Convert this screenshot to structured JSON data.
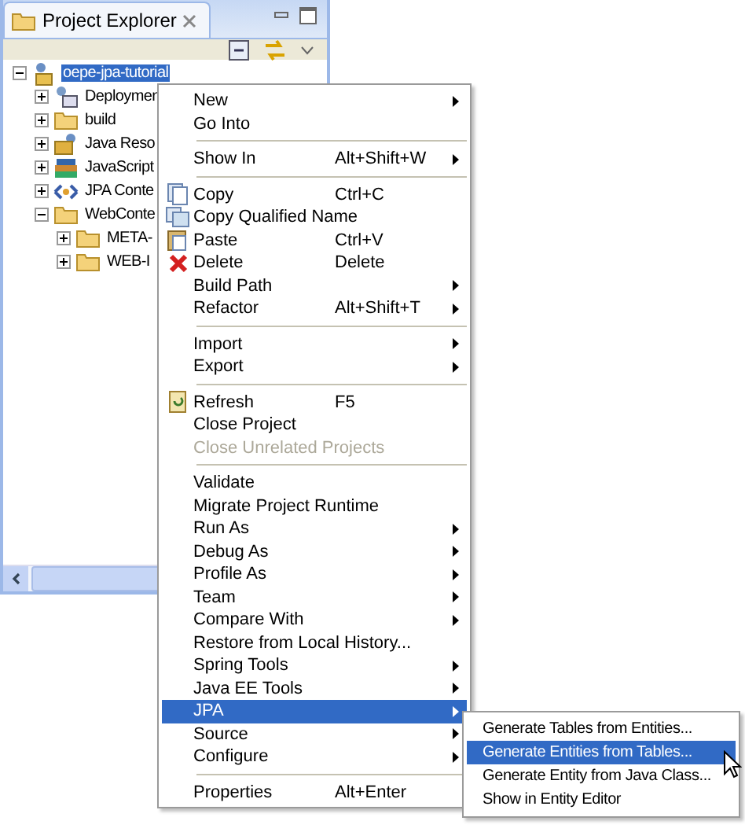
{
  "panel": {
    "title": "Project Explorer"
  },
  "tree": [
    {
      "label": "oepe-jpa-tutorial",
      "selected": true,
      "expanded": true,
      "children": [
        {
          "label": "Deploymen",
          "expanded": false
        },
        {
          "label": "build",
          "expanded": false
        },
        {
          "label": "Java Reso",
          "expanded": false
        },
        {
          "label": "JavaScript",
          "expanded": false
        },
        {
          "label": "JPA Conte",
          "expanded": false
        },
        {
          "label": "WebConte",
          "expanded": true,
          "children": [
            {
              "label": "META-",
              "expanded": false
            },
            {
              "label": "WEB-I",
              "expanded": false
            }
          ]
        }
      ]
    }
  ],
  "menu": [
    {
      "kind": "item",
      "label": "New",
      "submenu": true,
      "disabled": false,
      "selected": false
    },
    {
      "kind": "item",
      "label": "Go Into",
      "submenu": false,
      "disabled": false,
      "selected": false
    },
    {
      "kind": "separator"
    },
    {
      "kind": "item",
      "label": "Show In",
      "shortcut": "Alt+Shift+W",
      "submenu": true,
      "disabled": false,
      "selected": false
    },
    {
      "kind": "separator"
    },
    {
      "kind": "item",
      "label": "Copy",
      "shortcut": "Ctrl+C",
      "submenu": false,
      "disabled": false,
      "selected": false
    },
    {
      "kind": "item",
      "label": "Copy Qualified Name",
      "submenu": false,
      "disabled": false,
      "selected": false
    },
    {
      "kind": "item",
      "label": "Paste",
      "shortcut": "Ctrl+V",
      "submenu": false,
      "disabled": false,
      "selected": false
    },
    {
      "kind": "item",
      "label": "Delete",
      "shortcut": "Delete",
      "submenu": false,
      "disabled": false,
      "selected": false
    },
    {
      "kind": "item",
      "label": "Build Path",
      "submenu": true,
      "disabled": false,
      "selected": false
    },
    {
      "kind": "item",
      "label": "Refactor",
      "shortcut": "Alt+Shift+T",
      "submenu": true,
      "disabled": false,
      "selected": false
    },
    {
      "kind": "separator"
    },
    {
      "kind": "item",
      "label": "Import",
      "submenu": true,
      "disabled": false,
      "selected": false
    },
    {
      "kind": "item",
      "label": "Export",
      "submenu": true,
      "disabled": false,
      "selected": false
    },
    {
      "kind": "separator"
    },
    {
      "kind": "item",
      "label": "Refresh",
      "shortcut": "F5",
      "submenu": false,
      "disabled": false,
      "selected": false
    },
    {
      "kind": "item",
      "label": "Close Project",
      "submenu": false,
      "disabled": false,
      "selected": false
    },
    {
      "kind": "item",
      "label": "Close Unrelated Projects",
      "submenu": false,
      "disabled": true,
      "selected": false
    },
    {
      "kind": "separator"
    },
    {
      "kind": "item",
      "label": "Validate",
      "submenu": false,
      "disabled": false,
      "selected": false
    },
    {
      "kind": "item",
      "label": "Migrate Project Runtime",
      "submenu": false,
      "disabled": false,
      "selected": false
    },
    {
      "kind": "item",
      "label": "Run As",
      "submenu": true,
      "disabled": false,
      "selected": false
    },
    {
      "kind": "item",
      "label": "Debug As",
      "submenu": true,
      "disabled": false,
      "selected": false
    },
    {
      "kind": "item",
      "label": "Profile As",
      "submenu": true,
      "disabled": false,
      "selected": false
    },
    {
      "kind": "item",
      "label": "Team",
      "submenu": true,
      "disabled": false,
      "selected": false
    },
    {
      "kind": "item",
      "label": "Compare With",
      "submenu": true,
      "disabled": false,
      "selected": false
    },
    {
      "kind": "item",
      "label": "Restore from Local History...",
      "submenu": false,
      "disabled": false,
      "selected": false
    },
    {
      "kind": "item",
      "label": "Spring Tools",
      "submenu": true,
      "disabled": false,
      "selected": false
    },
    {
      "kind": "item",
      "label": "Java EE Tools",
      "submenu": true,
      "disabled": false,
      "selected": false
    },
    {
      "kind": "item",
      "label": "JPA",
      "submenu": true,
      "disabled": false,
      "selected": true
    },
    {
      "kind": "item",
      "label": "Source",
      "submenu": true,
      "disabled": false,
      "selected": false
    },
    {
      "kind": "item",
      "label": "Configure",
      "submenu": true,
      "disabled": false,
      "selected": false
    },
    {
      "kind": "separator"
    },
    {
      "kind": "item",
      "label": "Properties",
      "shortcut": "Alt+Enter",
      "submenu": false,
      "disabled": false,
      "selected": false
    }
  ],
  "submenu": [
    {
      "label": "Generate Tables from Entities...",
      "selected": false
    },
    {
      "label": "Generate Entities from Tables...",
      "selected": true
    },
    {
      "label": "Generate Entity from Java Class...",
      "selected": false
    },
    {
      "label": "Show in Entity Editor",
      "selected": false
    }
  ]
}
